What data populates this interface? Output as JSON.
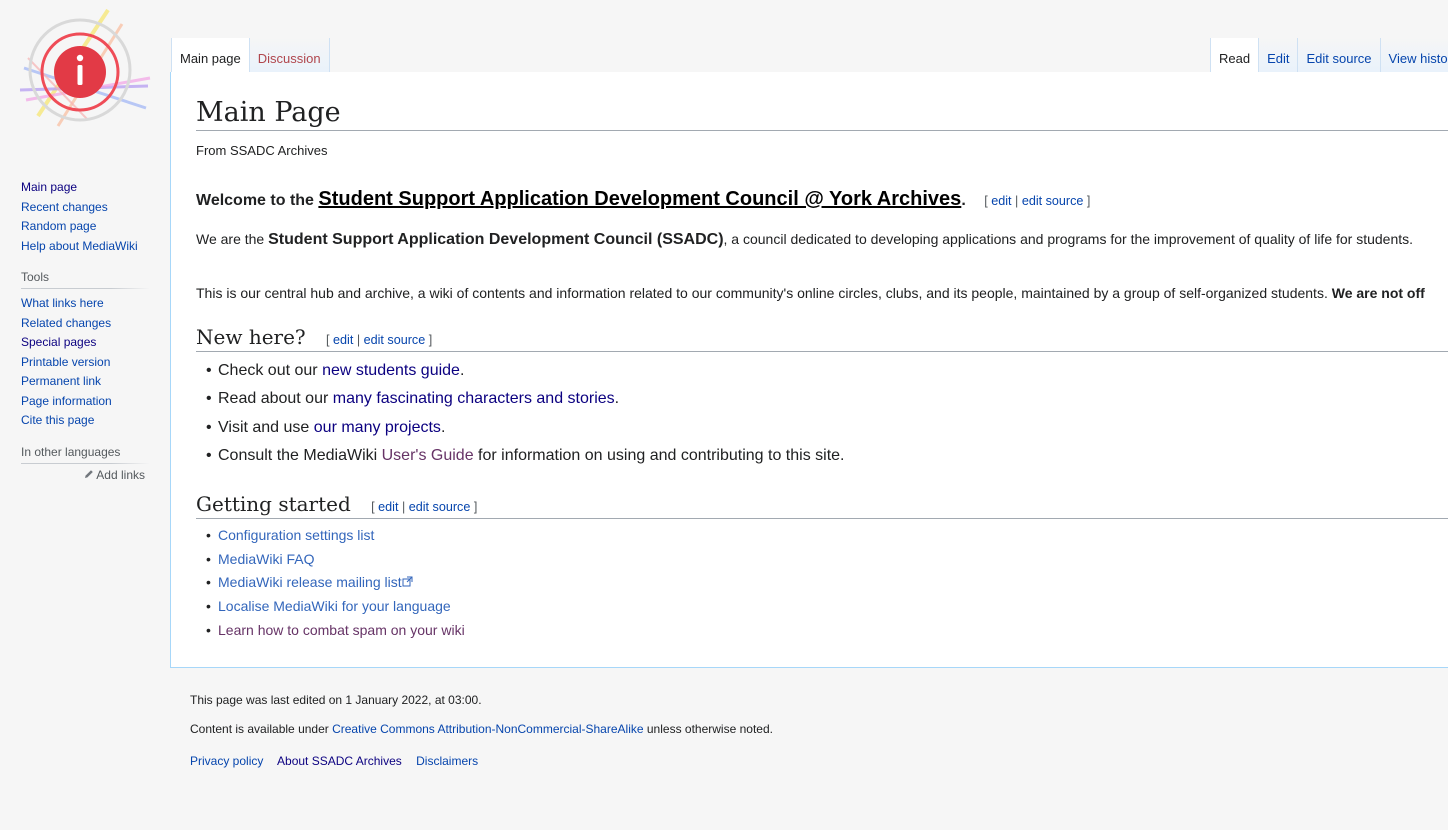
{
  "sidebar": {
    "navigation": [
      "Main page",
      "Recent changes",
      "Random page",
      "Help about MediaWiki"
    ],
    "tools_heading": "Tools",
    "tools": [
      "What links here",
      "Related changes",
      "Special pages",
      "Printable version",
      "Permanent link",
      "Page information",
      "Cite this page"
    ],
    "languages_heading": "In other languages",
    "add_links": "Add links"
  },
  "tabs": {
    "main_page": "Main page",
    "discussion": "Discussion",
    "read": "Read",
    "edit": "Edit",
    "edit_source": "Edit source",
    "view_history": "View histor"
  },
  "page": {
    "title": "Main Page",
    "site_sub": "From SSADC Archives",
    "welcome_prefix": "Welcome to the ",
    "welcome_link": "Student Support Application Development Council @ York Archives",
    "welcome_suffix": ".",
    "edit": "edit",
    "edit_source": "edit source",
    "intro_prefix": "We are the ",
    "intro_bold": "Student Support Application Development Council (SSADC)",
    "intro_suffix": ", a council dedicated to developing applications and programs for the improvement of quality of life for students.",
    "hub_text": "This is our central hub and archive, a wiki of contents and information related to our community's online circles, clubs, and its people, maintained by a group of self-organized students. ",
    "hub_bold": "We are not off",
    "new_here": {
      "heading": "New here?",
      "items": [
        {
          "pre": "Check out our ",
          "link": "new students guide",
          "post": "."
        },
        {
          "pre": "Read about our ",
          "link": "many fascinating characters and stories",
          "post": "."
        },
        {
          "pre": "Visit and use ",
          "link": "our many projects",
          "post": "."
        },
        {
          "pre": "Consult the MediaWiki ",
          "link": "User's Guide",
          "post": " for information on using and contributing to this site."
        }
      ]
    },
    "getting_started": {
      "heading": "Getting started",
      "items": [
        "Configuration settings list",
        "MediaWiki FAQ",
        "MediaWiki release mailing list",
        "Localise MediaWiki for your language",
        "Learn how to combat spam on your wiki"
      ]
    }
  },
  "footer": {
    "last_edited": "This page was last edited on 1 January 2022, at 03:00.",
    "license_prefix": "Content is available under ",
    "license_link": "Creative Commons Attribution-NonCommercial-ShareAlike",
    "license_suffix": " unless otherwise noted.",
    "places": [
      "Privacy policy",
      "About SSADC Archives",
      "Disclaimers"
    ]
  },
  "icons": [
    "wiki-logo-icon",
    "pencil-icon",
    "external-link-icon"
  ],
  "colors": {
    "link": "#0645ad",
    "visited_link": "#0b0080",
    "redlink": "#ba0000",
    "tab_border": "#a7d7f9"
  }
}
